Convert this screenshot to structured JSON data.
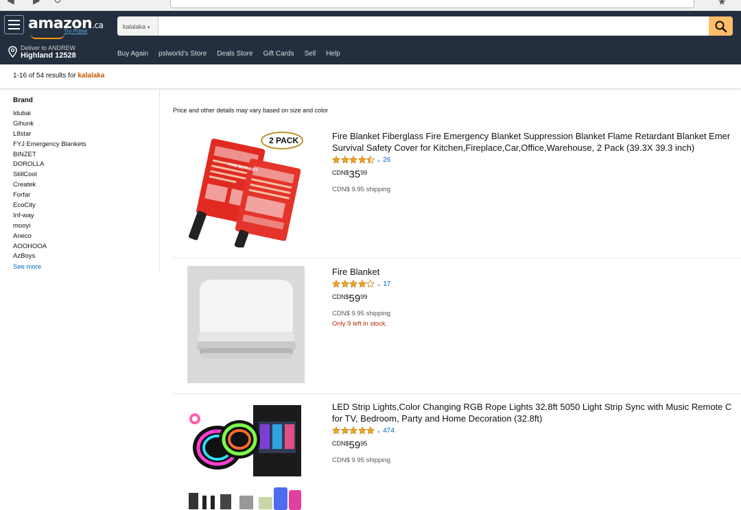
{
  "header": {
    "logo_text": "amazon",
    "logo_tld": ".ca",
    "try_prime": "Try Prime",
    "search_department": "kalalaka",
    "search_value": "",
    "deliver_line1": "Deliver to ANDREW",
    "deliver_line2": "Highland 12528",
    "nav_links": [
      "Buy Again",
      "pslworld's Store",
      "Deals Store",
      "Gift Cards",
      "Sell",
      "Help"
    ]
  },
  "results": {
    "summary": "1-16 of 54 results for ",
    "query": "kalalaka"
  },
  "sidebar": {
    "heading": "Brand",
    "brands": [
      "Idubai",
      "Gihunk",
      "L8star",
      "FYJ Emergency Blankets",
      "BINZET",
      "DOROLLA",
      "StillCool",
      "Createk",
      "Forfar",
      "EcoCity",
      "Inf-way",
      "mooyi",
      "Aneco",
      "AOOHOOA",
      "AzBoys"
    ],
    "see_more": "See more"
  },
  "main": {
    "note": "Price and other details may vary based on size and color",
    "products": [
      {
        "title_line1": "Fire Blanket Fiberglass Fire Emergency Blanket Suppression Blanket Flame Retardant Blanket Emer",
        "title_line2": "Survival Safety Cover for Kitchen,Fireplace,Car,Office,Warehouse, 2 Pack (39.3X 39.3 inch)",
        "rating": 4.5,
        "review_count": "26",
        "price_currency": "CDN$",
        "price_whole": "35",
        "price_fraction": "99",
        "shipping": "CDN$ 9.95 shipping",
        "stock": "",
        "badge": "2 PACK",
        "package_label": "FIRE BLANKET"
      },
      {
        "title_line1": "Fire Blanket",
        "title_line2": "",
        "rating": 4,
        "review_count": "17",
        "price_currency": "CDN$",
        "price_whole": "59",
        "price_fraction": "99",
        "shipping": "CDN$ 9.95 shipping",
        "stock": "Only 9 left in stock."
      },
      {
        "title_line1": "LED Strip Lights,Color Changing RGB Rope Lights 32.8ft 5050 Light Strip Sync with Music Remote C",
        "title_line2": "for TV, Bedroom, Party and Home Decoration (32.8ft)",
        "rating": 5,
        "review_count": "474",
        "price_currency": "CDN$",
        "price_whole": "59",
        "price_fraction": "95",
        "shipping": "CDN$ 9.95 shipping",
        "stock": ""
      }
    ]
  },
  "colors": {
    "header_bg": "#232f3e",
    "accent": "#febd69",
    "link": "#0066c0",
    "query": "#c45500",
    "star": "#f4a41c",
    "stock": "#b12704"
  }
}
